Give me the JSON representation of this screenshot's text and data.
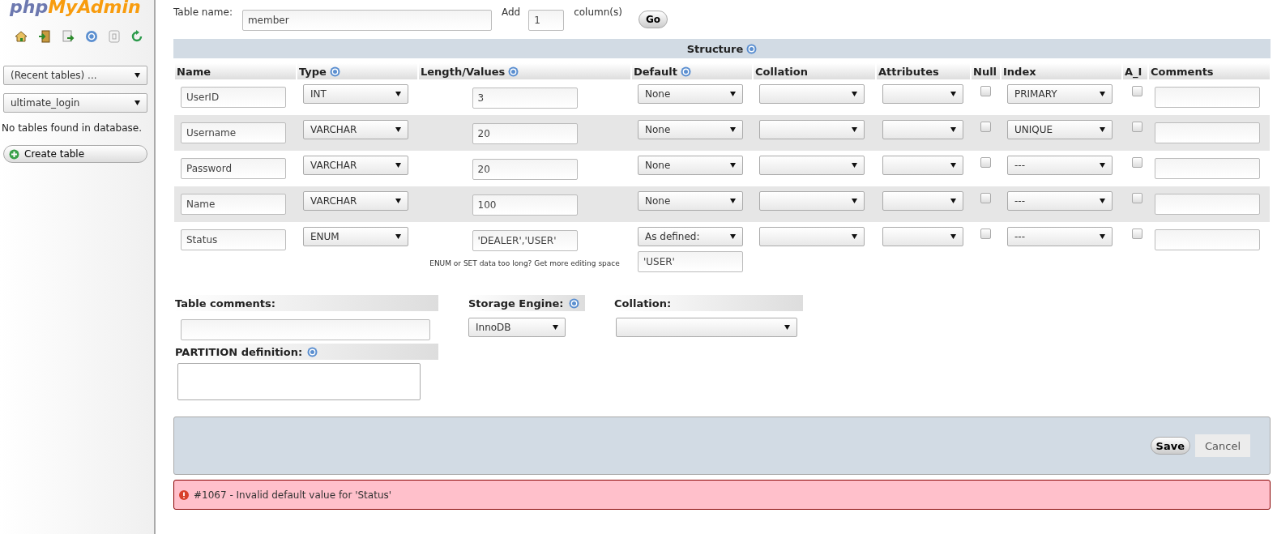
{
  "sidebar": {
    "logo": {
      "part1": "php",
      "part2": "MyAdmin"
    },
    "recent_tables": {
      "value": "(Recent tables) ..."
    },
    "database": {
      "value": "ultimate_login"
    },
    "message": "No tables found in database.",
    "create_button": "Create table"
  },
  "header": {
    "table_name_label": "Table name:",
    "table_name": "member",
    "add_label": "Add",
    "add_count": "1",
    "columns_label": "column(s)",
    "go_button": "Go"
  },
  "structure": {
    "title": "Structure",
    "columns": [
      {
        "label": "Name",
        "help": false
      },
      {
        "label": "Type",
        "help": true
      },
      {
        "label": "Length/Values",
        "help": true
      },
      {
        "label": "Default",
        "help": true
      },
      {
        "label": "Collation",
        "help": false
      },
      {
        "label": "Attributes",
        "help": false
      },
      {
        "label": "Null",
        "help": false
      },
      {
        "label": "Index",
        "help": false
      },
      {
        "label": "A_I",
        "help": false
      },
      {
        "label": "Comments",
        "help": false
      }
    ],
    "rows": [
      {
        "name": "UserID",
        "type": "INT",
        "length": "3",
        "default": "None",
        "null": false,
        "index": "PRIMARY",
        "ai": false
      },
      {
        "name": "Username",
        "type": "VARCHAR",
        "length": "20",
        "default": "None",
        "null": false,
        "index": "UNIQUE",
        "ai": false
      },
      {
        "name": "Password",
        "type": "VARCHAR",
        "length": "20",
        "default": "None",
        "null": false,
        "index": "---",
        "ai": false
      },
      {
        "name": "Name",
        "type": "VARCHAR",
        "length": "100",
        "default": "None",
        "null": false,
        "index": "---",
        "ai": false
      },
      {
        "name": "Status",
        "type": "ENUM",
        "length": "'DEALER','USER'",
        "length_hint": "ENUM or SET data too long? Get more editing space",
        "default": "As defined:",
        "default_value": "'USER'",
        "null": false,
        "index": "---",
        "ai": false
      }
    ]
  },
  "options": {
    "table_comments_label": "Table comments:",
    "storage_engine_label": "Storage Engine:",
    "storage_engine": "InnoDB",
    "collation_label": "Collation:",
    "partition_label": "PARTITION definition:"
  },
  "actions": {
    "save_button": "Save",
    "cancel_button": "Cancel"
  },
  "error": {
    "message": "#1067 - Invalid default value for 'Status'"
  }
}
